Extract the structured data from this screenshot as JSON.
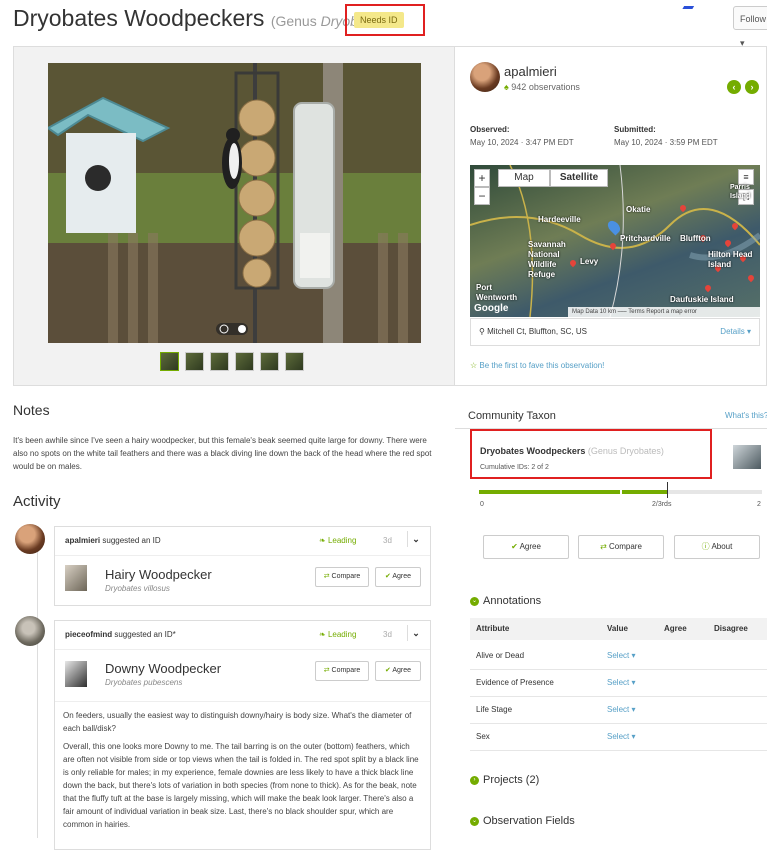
{
  "header": {
    "title": "Dryobates Woodpeckers",
    "genus_prefix": "(Genus ",
    "genus_name": "Dryobates",
    "needs_id": "Needs ID",
    "follow_label": "Follow ▾"
  },
  "photo": {
    "thumbnail_count": 6
  },
  "observer": {
    "username": "apalmieri",
    "observations": "942 observations",
    "observed_label": "Observed:",
    "observed_value": "May 10, 2024 · 3:47 PM EDT",
    "submitted_label": "Submitted:",
    "submitted_value": "May 10, 2024 · 3:59 PM EDT"
  },
  "map": {
    "map_tab": "Map",
    "satellite_tab": "Satellite",
    "labels": [
      "Okatie",
      "Hardeeville",
      "Savannah National Wildlife Refuge",
      "Pritchardville",
      "Bluffton",
      "Hilton Head Island",
      "Levy",
      "Port Wentworth",
      "Daufuskie Island",
      "Parris Island"
    ],
    "footer": "Map Data   10 km ⎯⎯⎯   Terms   Report a map error",
    "google": "Google"
  },
  "location": {
    "place": "Mitchell Ct, Bluffton, SC, US",
    "details": "Details ▾"
  },
  "fave": "Be the first to fave this observation!",
  "notes": {
    "heading": "Notes",
    "text": "It's been awhile since I've seen a hairy woodpecker, but this female's beak seemed quite large for downy. There were also no spots on the white tail feathers and there was a black diving line down the back of the head where the red spot would be on males."
  },
  "activity": {
    "heading": "Activity",
    "items": [
      {
        "user": "apalmieri",
        "action": " suggested an ID",
        "leading": "Leading",
        "days": "3d",
        "taxon_common": "Hairy Woodpecker",
        "taxon_sci": "Dryobates villosus",
        "compare": "Compare",
        "agree": "Agree"
      },
      {
        "user": "pieceofmind",
        "action": " suggested an ID*",
        "leading": "Leading",
        "days": "3d",
        "taxon_common": "Downy Woodpecker",
        "taxon_sci": "Dryobates pubescens",
        "compare": "Compare",
        "agree": "Agree",
        "comment_1": "On feeders, usually the easiest way to distinguish downy/hairy is body size. What's the diameter of each ball/disk?",
        "comment_2": "Overall, this one looks more Downy to me. The tail barring is on the outer (bottom) feathers, which are often not visible from side or top views when the tail is folded in. The red spot split by a black line is only reliable for males; in my experience, female downies are less likely to have a thick black line down the back, but there's lots of variation in both species (from none to thick). As for the beak, note that the fluffy tuft at the base is largely missing, which will make the beak look larger. There's also a fair amount of individual variation in beak size. Last, there's no black shoulder spur, which are common in hairies."
      }
    ]
  },
  "community_taxon": {
    "heading": "Community Taxon",
    "whats_this": "What's this?",
    "name": "Dryobates Woodpeckers",
    "genus": "(Genus Dryobates)",
    "cumulative": "Cumulative IDs: 2 of 2",
    "progress_fraction": 0.667,
    "scale_left": "0",
    "scale_mid": "2/3rds",
    "scale_right": "2",
    "agree": "Agree",
    "compare": "Compare",
    "about": "About"
  },
  "annotations": {
    "heading": "Annotations",
    "columns": [
      "Attribute",
      "Value",
      "Agree",
      "Disagree"
    ],
    "rows": [
      {
        "attribute": "Alive or Dead",
        "value": "Select ▾"
      },
      {
        "attribute": "Evidence of Presence",
        "value": "Select ▾"
      },
      {
        "attribute": "Life Stage",
        "value": "Select ▾"
      },
      {
        "attribute": "Sex",
        "value": "Select ▾"
      }
    ]
  },
  "projects": "Projects (2)",
  "observation_fields": "Observation Fields",
  "colors": {
    "accent_green": "#74ac00",
    "link_blue": "#57a0c7",
    "highlight_red": "#e02020",
    "needs_id_yellow": "#f4e88a"
  }
}
